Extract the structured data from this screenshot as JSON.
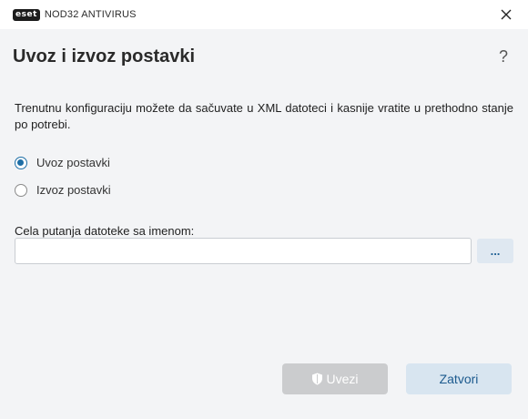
{
  "window": {
    "logo_text": "eset",
    "product_name": "NOD32 ANTIVIRUS"
  },
  "dialog": {
    "title": "Uvoz i izvoz postavki",
    "help_label": "?",
    "description": "Trenutnu konfiguraciju možete da sačuvate u XML datoteci i kasnije vratite u prethodno stanje po potrebi.",
    "options": [
      {
        "label": "Uvoz postavki",
        "selected": true
      },
      {
        "label": "Izvoz postavki",
        "selected": false
      }
    ],
    "path_field": {
      "label": "Cela putanja datoteke sa imenom:",
      "value": "",
      "browse_label": "..."
    },
    "buttons": {
      "import_label": "Uvezi",
      "close_label": "Zatvori"
    }
  },
  "colors": {
    "accent": "#1e6ea6",
    "disabled_button": "#cbccce",
    "secondary_button": "#d8e5f0"
  },
  "icons": {
    "close": "close-icon",
    "shield": "shield-icon"
  }
}
